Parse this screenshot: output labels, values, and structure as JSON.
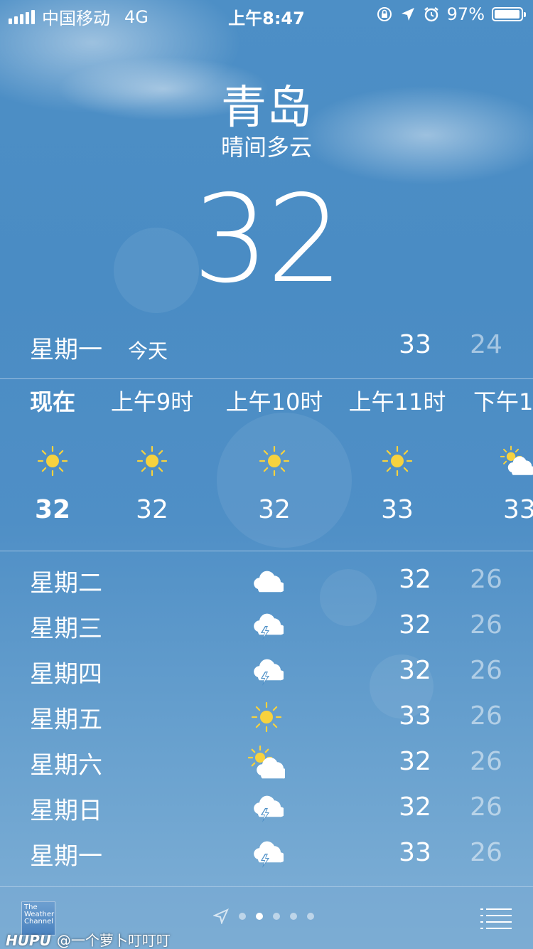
{
  "status_bar": {
    "carrier": "中国移动",
    "network": "4G",
    "time": "上午8:47",
    "battery_percent": "97%",
    "battery_level": 0.97,
    "icons": [
      "signal-icon",
      "rotation-lock-icon",
      "location-arrow-icon",
      "alarm-icon",
      "battery-icon"
    ]
  },
  "location": {
    "city": "青岛",
    "condition": "晴间多云",
    "current_temp": "32"
  },
  "today": {
    "day": "星期一",
    "label": "今天",
    "high": "33",
    "low": "24"
  },
  "hourly": [
    {
      "time": "现在",
      "icon": "sun-icon",
      "temp": "32",
      "now": true
    },
    {
      "time": "上午9时",
      "icon": "sun-icon",
      "temp": "32",
      "now": false
    },
    {
      "time": "上午10时",
      "icon": "sun-icon",
      "temp": "32",
      "now": false
    },
    {
      "time": "上午11时",
      "icon": "sun-icon",
      "temp": "33",
      "now": false
    },
    {
      "time": "下午1",
      "icon": "partly-cloudy-icon",
      "temp": "33",
      "now": false
    }
  ],
  "daily": [
    {
      "day": "星期二",
      "icon": "cloud-icon",
      "high": "32",
      "low": "26"
    },
    {
      "day": "星期三",
      "icon": "thunderstorm-icon",
      "high": "32",
      "low": "26"
    },
    {
      "day": "星期四",
      "icon": "thunderstorm-icon",
      "high": "32",
      "low": "26"
    },
    {
      "day": "星期五",
      "icon": "sun-icon",
      "high": "33",
      "low": "26"
    },
    {
      "day": "星期六",
      "icon": "partly-cloudy-icon",
      "high": "32",
      "low": "26"
    },
    {
      "day": "星期日",
      "icon": "thunderstorm-icon",
      "high": "32",
      "low": "26"
    },
    {
      "day": "星期一",
      "icon": "thunderstorm-icon",
      "high": "33",
      "low": "26"
    }
  ],
  "bottom_bar": {
    "logo_text": "The Weather Channel",
    "pages": 5,
    "active_page": 2
  },
  "watermark": {
    "brand": "HUPU",
    "handle": "@一个萝卜叮叮叮"
  },
  "colors": {
    "sun": "#f7d23e",
    "sky": "#4d8fc6"
  }
}
